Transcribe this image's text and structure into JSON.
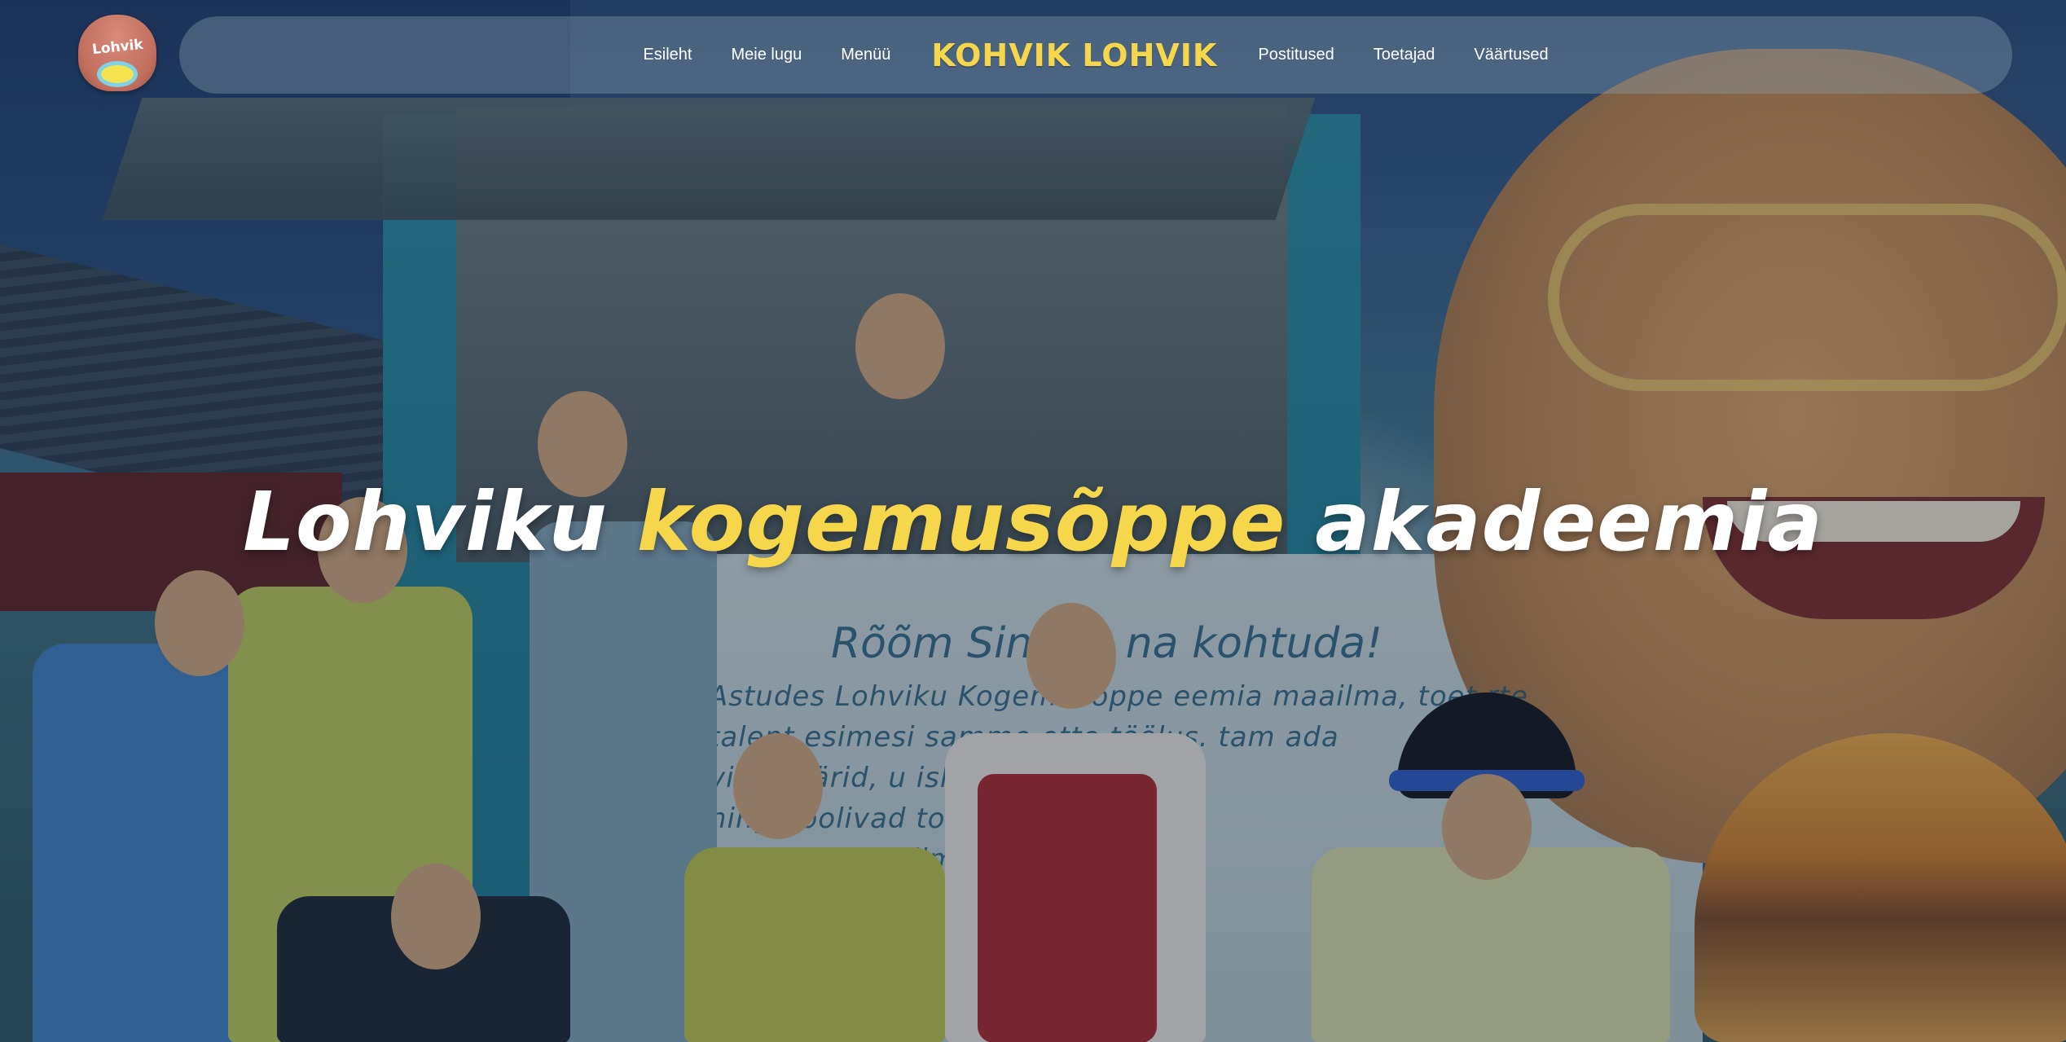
{
  "brand": {
    "logo_text": "Lohvik",
    "name": "KOHVIK LOHVIK"
  },
  "nav": {
    "left": [
      "Esileht",
      "Meie lugu",
      "Menüü"
    ],
    "right": [
      "Postitused",
      "Toetajad",
      "Väärtused"
    ]
  },
  "hero": {
    "headline_part1": "Lohviku",
    "headline_highlight": "kogemusõppe",
    "headline_part3": "akadeemia"
  },
  "mural": {
    "heading": "Rõõm Sinuga   na kohtuda!",
    "lines": [
      "Astudes Lohviku Kogemusõppe    eemia maailma, toet    rte",
      "talent    esimesi samme ette       töölus.    tam     ada",
      "visionäärid, u                 iskonna  liikmed,    ed",
      "ning hoolivad                  toetu  inspi",
      "tama suurel                  ailma"
    ]
  },
  "colors": {
    "accent": "#f6d64a",
    "nav_text": "#ffffff"
  }
}
